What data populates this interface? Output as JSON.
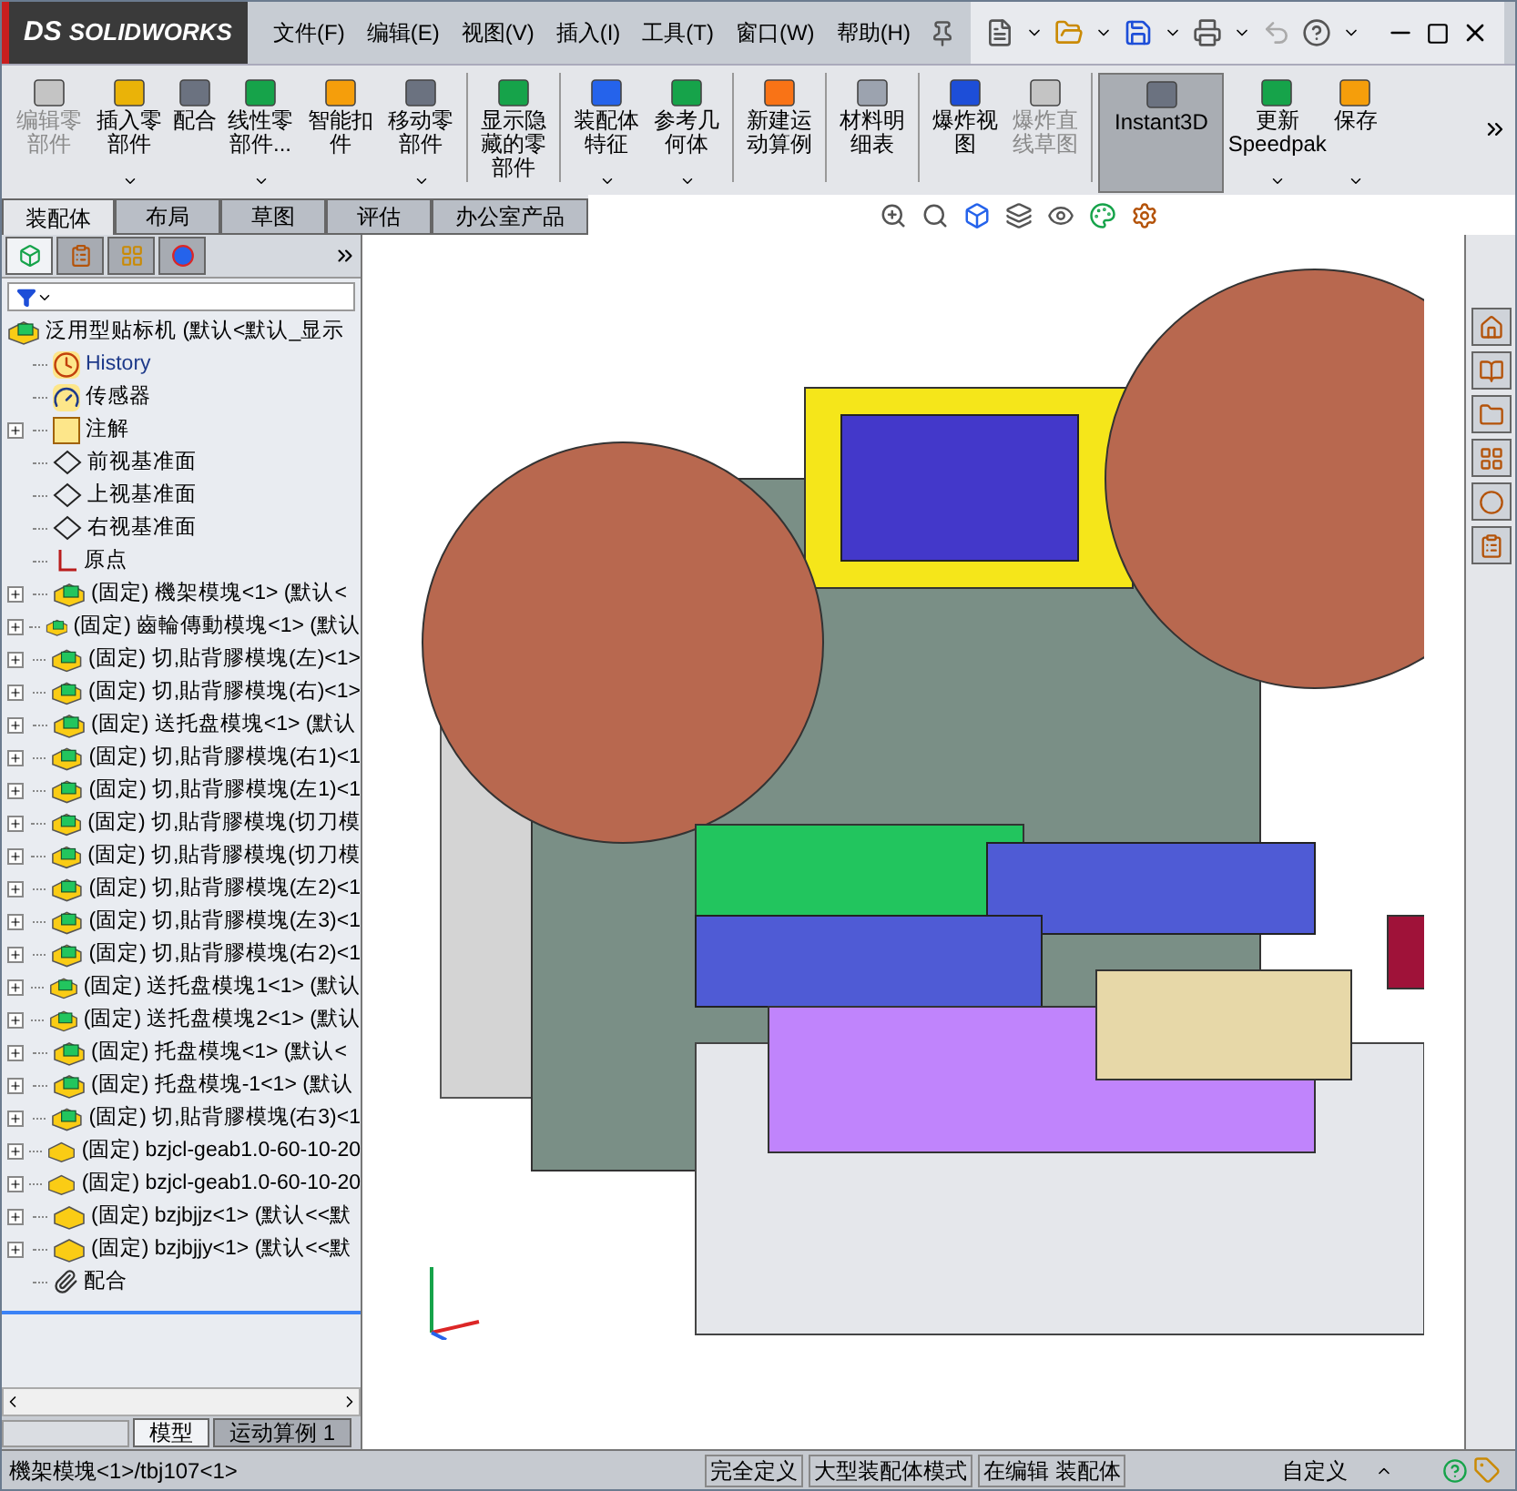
{
  "app": {
    "logo_mark": "DS",
    "logo_text": "SOLIDWORKS"
  },
  "menu": [
    "文件(F)",
    "编辑(E)",
    "视图(V)",
    "插入(I)",
    "工具(T)",
    "窗口(W)",
    "帮助(H)"
  ],
  "ribbon": [
    [
      {
        "label": "编辑零部件",
        "disabled": true,
        "dropdown": false,
        "selected": false
      },
      {
        "label": "插入零部件",
        "disabled": false,
        "dropdown": true,
        "selected": false
      },
      {
        "label": "配合",
        "disabled": false,
        "dropdown": false,
        "selected": false
      },
      {
        "label": "线性零部件...",
        "disabled": false,
        "dropdown": true,
        "selected": false
      },
      {
        "label": "智能扣件",
        "disabled": false,
        "dropdown": false,
        "selected": false
      },
      {
        "label": "移动零部件",
        "disabled": false,
        "dropdown": true,
        "selected": false
      }
    ],
    [
      {
        "label": "显示隐藏的零部件",
        "disabled": false,
        "dropdown": false,
        "selected": false
      }
    ],
    [
      {
        "label": "装配体特征",
        "disabled": false,
        "dropdown": true,
        "selected": false
      },
      {
        "label": "参考几何体",
        "disabled": false,
        "dropdown": true,
        "selected": false
      }
    ],
    [
      {
        "label": "新建运动算例",
        "disabled": false,
        "dropdown": false,
        "selected": false
      }
    ],
    [
      {
        "label": "材料明细表",
        "disabled": false,
        "dropdown": false,
        "selected": false
      }
    ],
    [
      {
        "label": "爆炸视图",
        "disabled": false,
        "dropdown": false,
        "selected": false
      },
      {
        "label": "爆炸直线草图",
        "disabled": true,
        "dropdown": false,
        "selected": false
      }
    ],
    [
      {
        "label": "Instant3D",
        "disabled": false,
        "dropdown": false,
        "selected": true
      },
      {
        "label": "更新 Speedpak",
        "disabled": false,
        "dropdown": true,
        "selected": false
      },
      {
        "label": "保存",
        "disabled": false,
        "dropdown": true,
        "selected": false
      }
    ]
  ],
  "command_tabs": [
    {
      "label": "装配体",
      "selected": true
    },
    {
      "label": "布局",
      "selected": false
    },
    {
      "label": "草图",
      "selected": false
    },
    {
      "label": "评估",
      "selected": false
    },
    {
      "label": "办公室产品",
      "selected": false
    }
  ],
  "panel_tabs": [
    {
      "kind": "tree",
      "selected": true
    },
    {
      "kind": "property",
      "selected": false
    },
    {
      "kind": "config",
      "selected": false
    },
    {
      "kind": "display",
      "selected": false
    }
  ],
  "tree": {
    "root": "泛用型贴标机 (默认<默认_显示",
    "children": [
      {
        "kind": "history",
        "label": "History"
      },
      {
        "kind": "folder",
        "label": "传感器"
      },
      {
        "kind": "annotation",
        "label": "注解",
        "expanded": false
      },
      {
        "kind": "plane",
        "label": "前视基准面"
      },
      {
        "kind": "plane",
        "label": "上视基准面"
      },
      {
        "kind": "plane",
        "label": "右视基准面"
      },
      {
        "kind": "origin",
        "label": "原点"
      },
      {
        "kind": "assembly",
        "label": "(固定) 機架模塊<1> (默认<",
        "expanded": false
      },
      {
        "kind": "assembly",
        "label": "(固定) 齒輪傳動模塊<1> (默认",
        "expanded": false
      },
      {
        "kind": "assembly",
        "label": "(固定) 切,貼背膠模塊(左)<1>",
        "expanded": false
      },
      {
        "kind": "assembly",
        "label": "(固定) 切,貼背膠模塊(右)<1>",
        "expanded": false
      },
      {
        "kind": "assembly",
        "label": "(固定) 送托盘模塊<1> (默认",
        "expanded": false
      },
      {
        "kind": "assembly",
        "label": "(固定) 切,貼背膠模塊(右1)<1",
        "expanded": false
      },
      {
        "kind": "assembly",
        "label": "(固定) 切,貼背膠模塊(左1)<1",
        "expanded": false
      },
      {
        "kind": "assembly",
        "label": "(固定) 切,貼背膠模塊(切刀模",
        "expanded": false
      },
      {
        "kind": "assembly",
        "label": "(固定) 切,貼背膠模塊(切刀模",
        "expanded": false
      },
      {
        "kind": "assembly",
        "label": "(固定) 切,貼背膠模塊(左2)<1",
        "expanded": false
      },
      {
        "kind": "assembly",
        "label": "(固定) 切,貼背膠模塊(左3)<1",
        "expanded": false
      },
      {
        "kind": "assembly",
        "label": "(固定) 切,貼背膠模塊(右2)<1",
        "expanded": false
      },
      {
        "kind": "assembly",
        "label": "(固定) 送托盘模塊1<1> (默认",
        "expanded": false
      },
      {
        "kind": "assembly",
        "label": "(固定) 送托盘模塊2<1> (默认",
        "expanded": false
      },
      {
        "kind": "assembly",
        "label": "(固定) 托盘模塊<1> (默认<",
        "expanded": false
      },
      {
        "kind": "assembly",
        "label": "(固定) 托盘模塊-1<1> (默认",
        "expanded": false
      },
      {
        "kind": "assembly",
        "label": "(固定) 切,貼背膠模塊(右3)<1",
        "expanded": false
      },
      {
        "kind": "part",
        "label": "(固定) bzjcl-geab1.0-60-10-20",
        "expanded": false
      },
      {
        "kind": "part",
        "label": "(固定) bzjcl-geab1.0-60-10-20",
        "expanded": false
      },
      {
        "kind": "part",
        "label": "(固定) bzjbjjz<1> (默认<<默",
        "expanded": false
      },
      {
        "kind": "part",
        "label": "(固定) bzjbjjy<1> (默认<<默",
        "expanded": false
      },
      {
        "kind": "mates",
        "label": "配合"
      }
    ]
  },
  "bottom_tabs": [
    {
      "label": "模型",
      "selected": true
    },
    {
      "label": "运动算例 1",
      "selected": false
    }
  ],
  "status_bar": {
    "selection": "機架模塊<1>/tbj107<1>",
    "fields": [
      "完全定义",
      "大型装配体模式",
      "在编辑 装配体"
    ],
    "units": "自定义"
  },
  "task_pane": [
    {
      "kind": "home"
    },
    {
      "kind": "library"
    },
    {
      "kind": "folder"
    },
    {
      "kind": "palette"
    },
    {
      "kind": "appearance"
    },
    {
      "kind": "properties"
    }
  ]
}
